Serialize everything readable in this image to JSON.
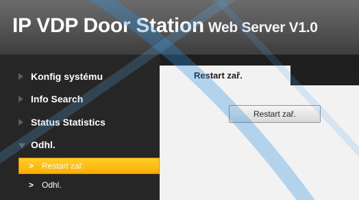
{
  "header": {
    "title": "IP VDP Door Station",
    "subtitle": "Web Server V1.0"
  },
  "sidebar": {
    "items": [
      {
        "label": "Konfig systému",
        "icon": "triangle-right-icon"
      },
      {
        "label": "Info Search",
        "icon": "triangle-right-icon"
      },
      {
        "label": "Status Statistics",
        "icon": "triangle-right-icon"
      },
      {
        "label": "Odhl.",
        "icon": "triangle-down-icon",
        "expanded": true
      }
    ],
    "subitems": [
      {
        "label": "Restart zař.",
        "prefix": ">",
        "active": true
      },
      {
        "label": "Odhl.",
        "prefix": ">",
        "active": false
      }
    ]
  },
  "main": {
    "tab_label": "Restart zař.",
    "restart_button_label": "Restart zař."
  },
  "colors": {
    "accent": "#ffb800",
    "sidebar_bg": "#262626",
    "panel_bg": "#f2f2f2"
  }
}
